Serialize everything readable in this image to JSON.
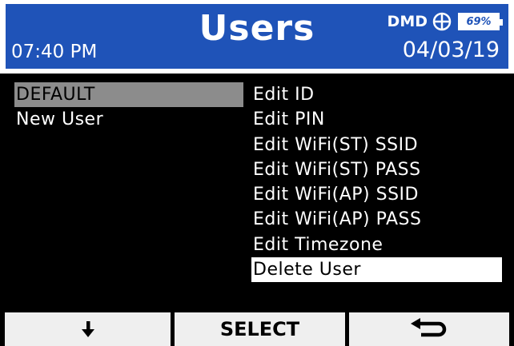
{
  "header": {
    "title": "Users",
    "time": "07:40 PM",
    "date": "04/03/19",
    "brand": "DMD",
    "battery_percent": "69%",
    "status_icon": "globe-crosshair-icon",
    "bar_color": "#1f53b8"
  },
  "users": {
    "items": [
      {
        "label": "DEFAULT",
        "selected": true
      },
      {
        "label": "New User",
        "selected": false
      }
    ]
  },
  "actions": {
    "items": [
      {
        "label": "Edit ID",
        "selected": false
      },
      {
        "label": "Edit PIN",
        "selected": false
      },
      {
        "label": "Edit WiFi(ST) SSID",
        "selected": false
      },
      {
        "label": "Edit WiFi(ST) PASS",
        "selected": false
      },
      {
        "label": "Edit WiFi(AP) SSID",
        "selected": false
      },
      {
        "label": "Edit WiFi(AP) PASS",
        "selected": false
      },
      {
        "label": "Edit Timezone",
        "selected": false
      },
      {
        "label": "Delete User",
        "selected": true
      }
    ]
  },
  "softkeys": {
    "down_icon": "down-arrow-icon",
    "select_label": "SELECT",
    "back_icon": "back-arrow-icon"
  }
}
